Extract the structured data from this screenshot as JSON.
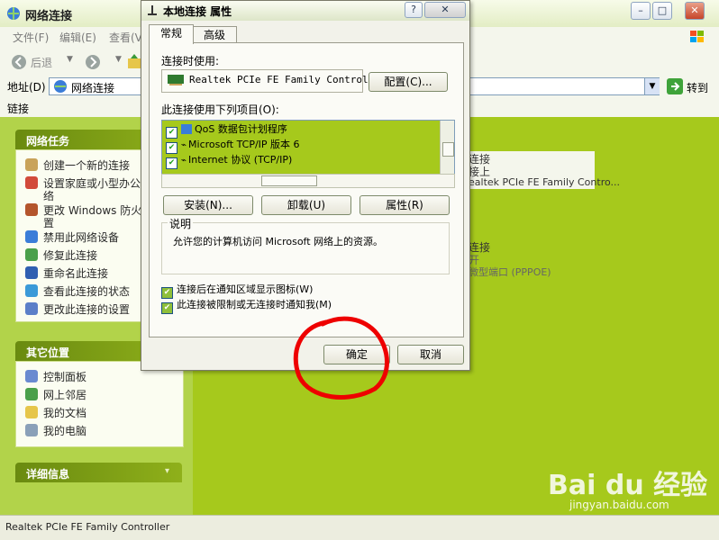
{
  "window": {
    "title": "网络连接",
    "min_label": "–",
    "max_label": "□",
    "close_label": "✕"
  },
  "menu": [
    "文件(F)",
    "编辑(E)",
    "查看(V"
  ],
  "toolbar": {
    "back_label": "后退"
  },
  "address": {
    "label": "地址(D)",
    "value": "网络连接",
    "go_label": "转到"
  },
  "links_label": "链接",
  "left": {
    "network_tasks": {
      "title": "网络任务",
      "items": [
        "创建一个新的连接",
        "设置家庭或小型办公",
        "络",
        "更改 Windows 防火墙",
        "置",
        "禁用此网络设备",
        "修复此连接",
        "重命名此连接",
        "查看此连接的状态",
        "更改此连接的设置"
      ]
    },
    "other_places": {
      "title": "其它位置",
      "items": [
        "控制面板",
        "网上邻居",
        "我的文档",
        "我的电脑"
      ]
    },
    "details": {
      "title": "详细信息"
    }
  },
  "right": {
    "conn1": [
      "连接",
      "接上",
      "ealtek PCIe FE Family Contro..."
    ],
    "conn2": [
      "连接",
      "开",
      "微型端口 (PPPOE)"
    ]
  },
  "statusbar": "Realtek PCIe FE Family Controller",
  "dialog": {
    "title": "本地连接 属性",
    "close_label": "✕",
    "help_label": "?",
    "tabs": [
      "常规",
      "高级"
    ],
    "connect_using_label": "连接时使用:",
    "adapter": "Realtek PCIe FE Family Control",
    "configure_label": "配置(C)...",
    "items_label": "此连接使用下列项目(O):",
    "items": [
      "QoS 数据包计划程序",
      "Microsoft TCP/IP 版本 6",
      "Internet 协议 (TCP/IP)"
    ],
    "install_label": "安装(N)...",
    "uninstall_label": "卸载(U)",
    "properties_label": "属性(R)",
    "description_group": "说明",
    "description_text": "允许您的计算机访问 Microsoft 网络上的资源。",
    "show_icon_label": "连接后在通知区域显示图标(W)",
    "notify_label": "此连接被限制或无连接时通知我(M)",
    "ok_label": "确定",
    "cancel_label": "取消"
  },
  "watermark": {
    "brand": "Bai du 经验",
    "url": "jingyan.baidu.com"
  },
  "colors": {
    "desktop": "#a6c91c",
    "annotation": "#ee0000"
  }
}
